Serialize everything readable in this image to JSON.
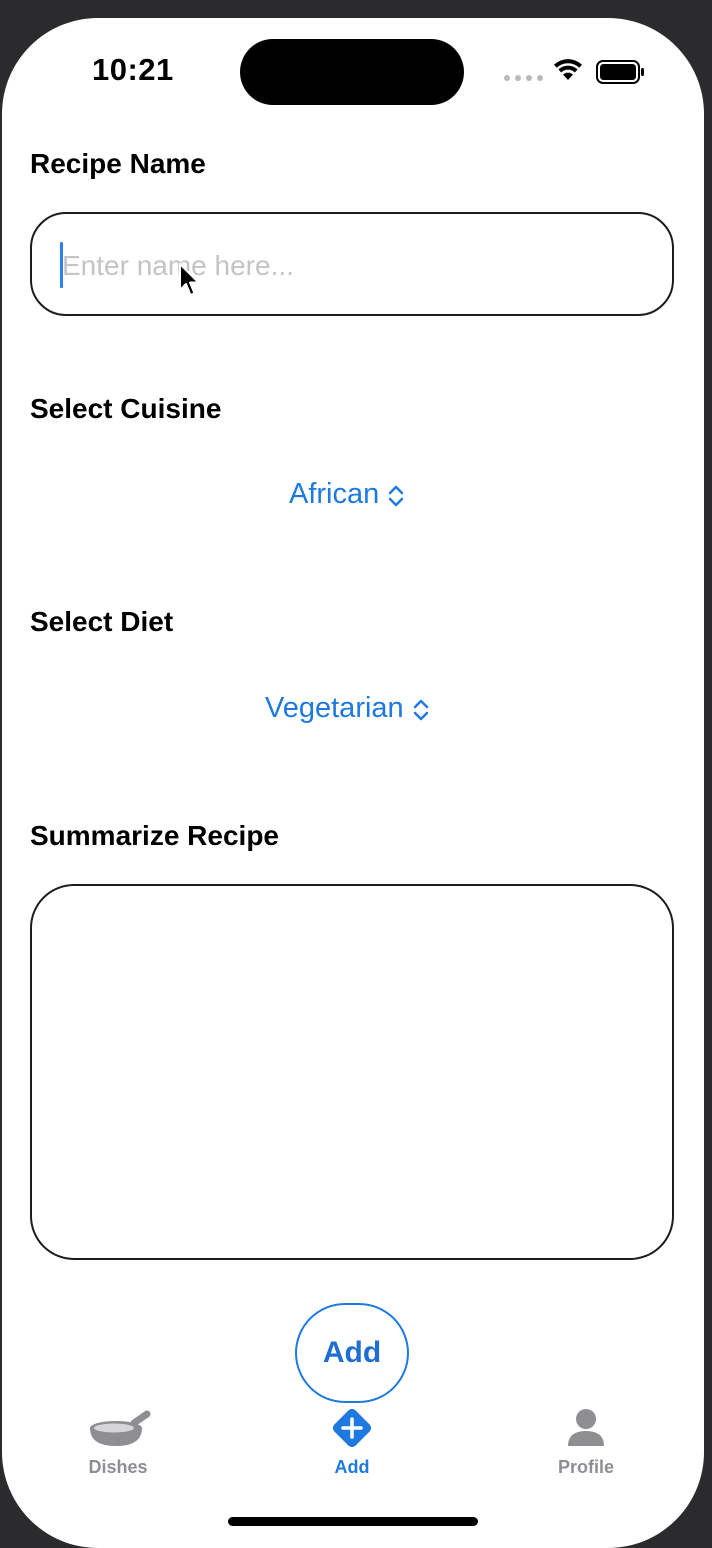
{
  "status": {
    "time": "10:21"
  },
  "form": {
    "recipe_name_label": "Recipe Name",
    "recipe_name_placeholder": "Enter name here...",
    "cuisine_label": "Select Cuisine",
    "cuisine_value": "African",
    "diet_label": "Select Diet",
    "diet_value": "Vegetarian",
    "summary_label": "Summarize Recipe",
    "summary_value": ""
  },
  "add_button": {
    "label": "Add"
  },
  "tabs": [
    {
      "label": "Dishes",
      "icon": "dish-icon",
      "active": false
    },
    {
      "label": "Add",
      "icon": "add-icon",
      "active": true
    },
    {
      "label": "Profile",
      "icon": "profile-icon",
      "active": false
    }
  ],
  "colors": {
    "accent": "#1f7ae0",
    "inactive_tab": "#8e8e93",
    "placeholder": "#c4c4c8"
  }
}
